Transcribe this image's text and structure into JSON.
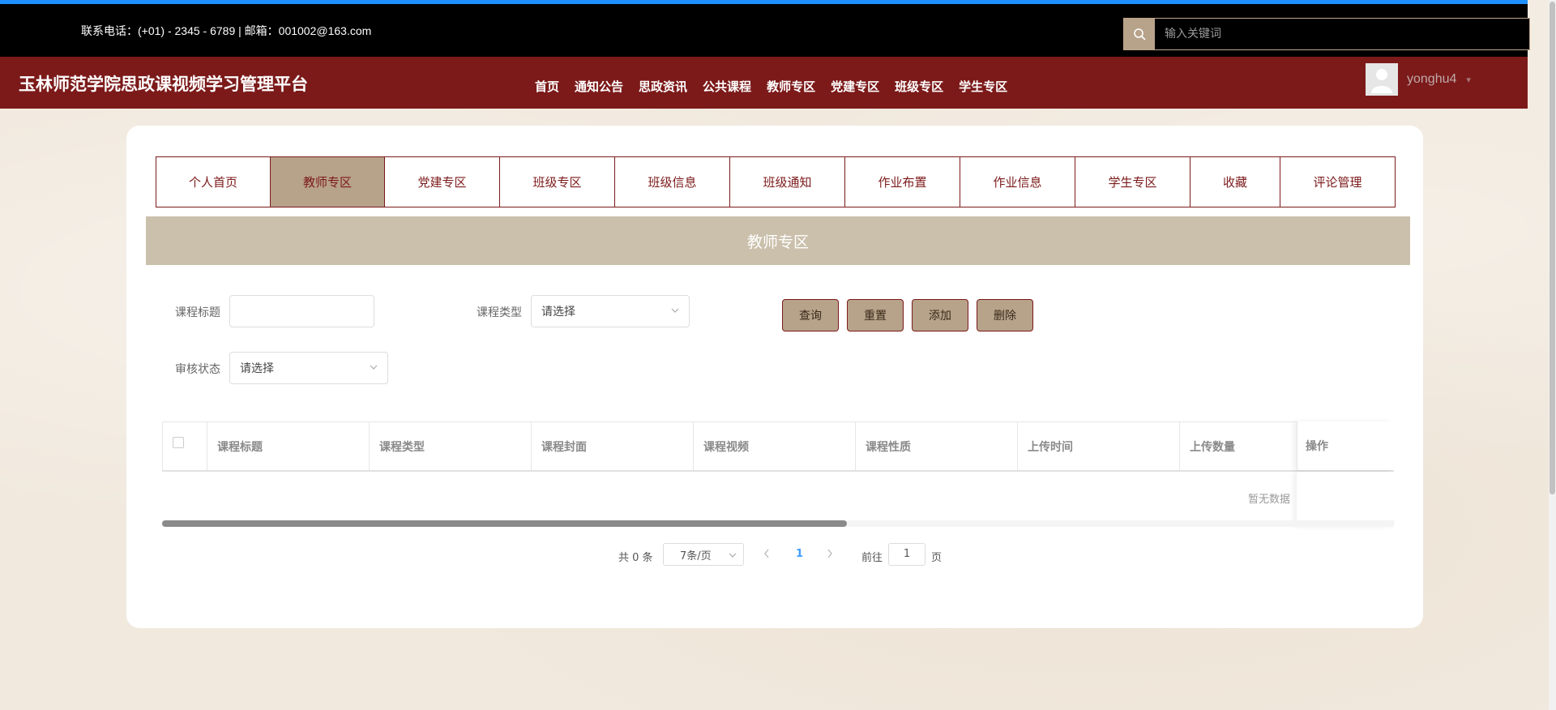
{
  "header": {
    "contact": "联系电话：(+01) - 2345 - 6789 | 邮箱：001002@163.com",
    "search_placeholder": "输入关键词",
    "site_title": "玉林师范学院思政课视频学习管理平台",
    "nav": [
      "首页",
      "通知公告",
      "思政资讯",
      "公共课程",
      "教师专区",
      "党建专区",
      "班级专区",
      "学生专区"
    ],
    "username": "yonghu4"
  },
  "tabs": [
    {
      "label": "个人首页",
      "active": false
    },
    {
      "label": "教师专区",
      "active": true
    },
    {
      "label": "党建专区",
      "active": false
    },
    {
      "label": "班级专区",
      "active": false
    },
    {
      "label": "班级信息",
      "active": false
    },
    {
      "label": "班级通知",
      "active": false
    },
    {
      "label": "作业布置",
      "active": false
    },
    {
      "label": "作业信息",
      "active": false
    },
    {
      "label": "学生专区",
      "active": false
    },
    {
      "label": "收藏",
      "active": false
    },
    {
      "label": "评论管理",
      "active": false
    }
  ],
  "section_title": "教师专区",
  "filters": {
    "title_label": "课程标题",
    "title_value": "",
    "type_label": "课程类型",
    "type_value": "请选择",
    "status_label": "审核状态",
    "status_value": "请选择"
  },
  "buttons": {
    "query": "查询",
    "reset": "重置",
    "add": "添加",
    "delete": "删除"
  },
  "table": {
    "columns": [
      "课程标题",
      "课程类型",
      "课程封面",
      "课程视频",
      "课程性质",
      "上传时间",
      "上传数量"
    ],
    "operation_column": "操作",
    "empty_text": "暂无数据",
    "rows": []
  },
  "pagination": {
    "total": "共 0 条",
    "page_size": "7条/页",
    "current_page": "1",
    "goto_label": "前往",
    "goto_value": "1",
    "page_unit": "页"
  },
  "colors": {
    "brand": "#7c1a1a",
    "accent": "#b7a28a",
    "section_bar": "#cbc0ac"
  }
}
